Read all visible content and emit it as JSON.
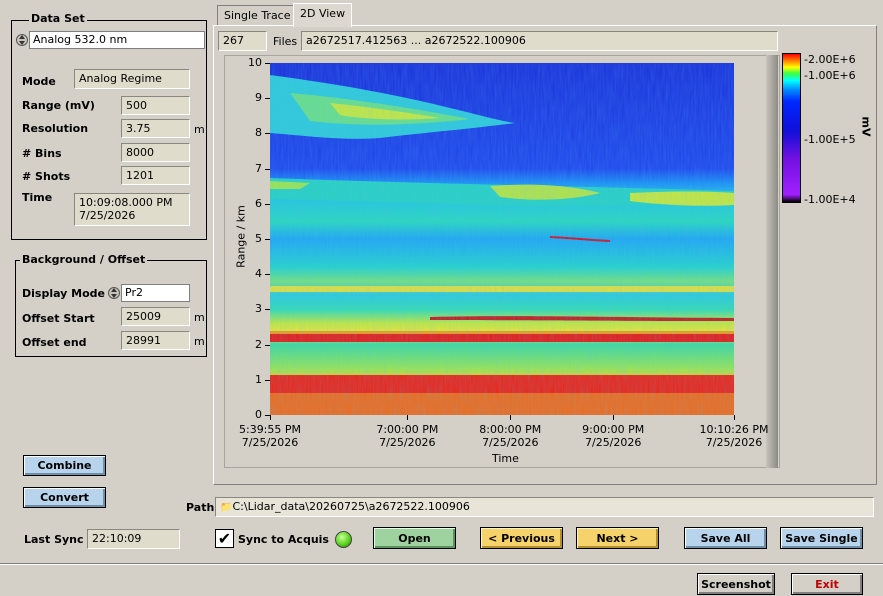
{
  "dataset": {
    "title": "Data Set",
    "channel": "Analog 532.0 nm",
    "mode_label": "Mode",
    "mode_value": "Analog Regime",
    "range_label": "Range (mV)",
    "range_value": "500",
    "resolution_label": "Resolution",
    "resolution_value": "3.75",
    "resolution_unit": "m",
    "bins_label": "# Bins",
    "bins_value": "8000",
    "shots_label": "# Shots",
    "shots_value": "1201",
    "time_label": "Time",
    "time_value": "10:09:08.000 PM",
    "date_value": "7/25/2026"
  },
  "background": {
    "title": "Background / Offset",
    "display_mode_label": "Display Mode",
    "display_mode_value": "Pr2",
    "offset_start_label": "Offset Start",
    "offset_start_value": "25009",
    "offset_start_unit": "m",
    "offset_end_label": "Offset end",
    "offset_end_value": "28991",
    "offset_end_unit": "m"
  },
  "buttons": {
    "combine": "Combine",
    "convert": "Convert",
    "open": "Open",
    "previous": "< Previous",
    "next": "Next >",
    "save_all": "Save All",
    "save_single": "Save Single",
    "screenshot": "Screenshot",
    "exit": "Exit"
  },
  "tabs": {
    "single_trace": "Single Trace",
    "view_2d": "2D View"
  },
  "files": {
    "count": "267",
    "label": "Files",
    "range": "a2672517.412563 ... a2672522.100906"
  },
  "path": {
    "label": "Path",
    "value": "C:\\Lidar_data\\20260725\\a2672522.100906"
  },
  "sync": {
    "last_sync_label": "Last Sync",
    "last_sync_value": "22:10:09",
    "sync_label": "Sync to Acquis",
    "sync_checked": true
  },
  "colors": {
    "led": "#5ad41c",
    "exit_text": "#c00000"
  },
  "chart_data": {
    "type": "heatmap",
    "ylabel": "Range / km",
    "xlabel": "Time",
    "ylim": [
      0,
      10
    ],
    "y_ticks": [
      "0",
      "1",
      "2",
      "3",
      "4",
      "5",
      "6",
      "7",
      "8",
      "9",
      "10"
    ],
    "x_ticks": [
      {
        "time": "5:39:55 PM",
        "date": "7/25/2026"
      },
      {
        "time": "7:00:00 PM",
        "date": "7/25/2026"
      },
      {
        "time": "8:00:00 PM",
        "date": "7/25/2026"
      },
      {
        "time": "9:00:00 PM",
        "date": "7/25/2026"
      },
      {
        "time": "10:10:26 PM",
        "date": "7/25/2026"
      }
    ],
    "colorbar": {
      "unit": "mV",
      "ticks": [
        "2.00E+6",
        "1.00E+6",
        "1.00E+5",
        "1.00E+4"
      ]
    }
  }
}
